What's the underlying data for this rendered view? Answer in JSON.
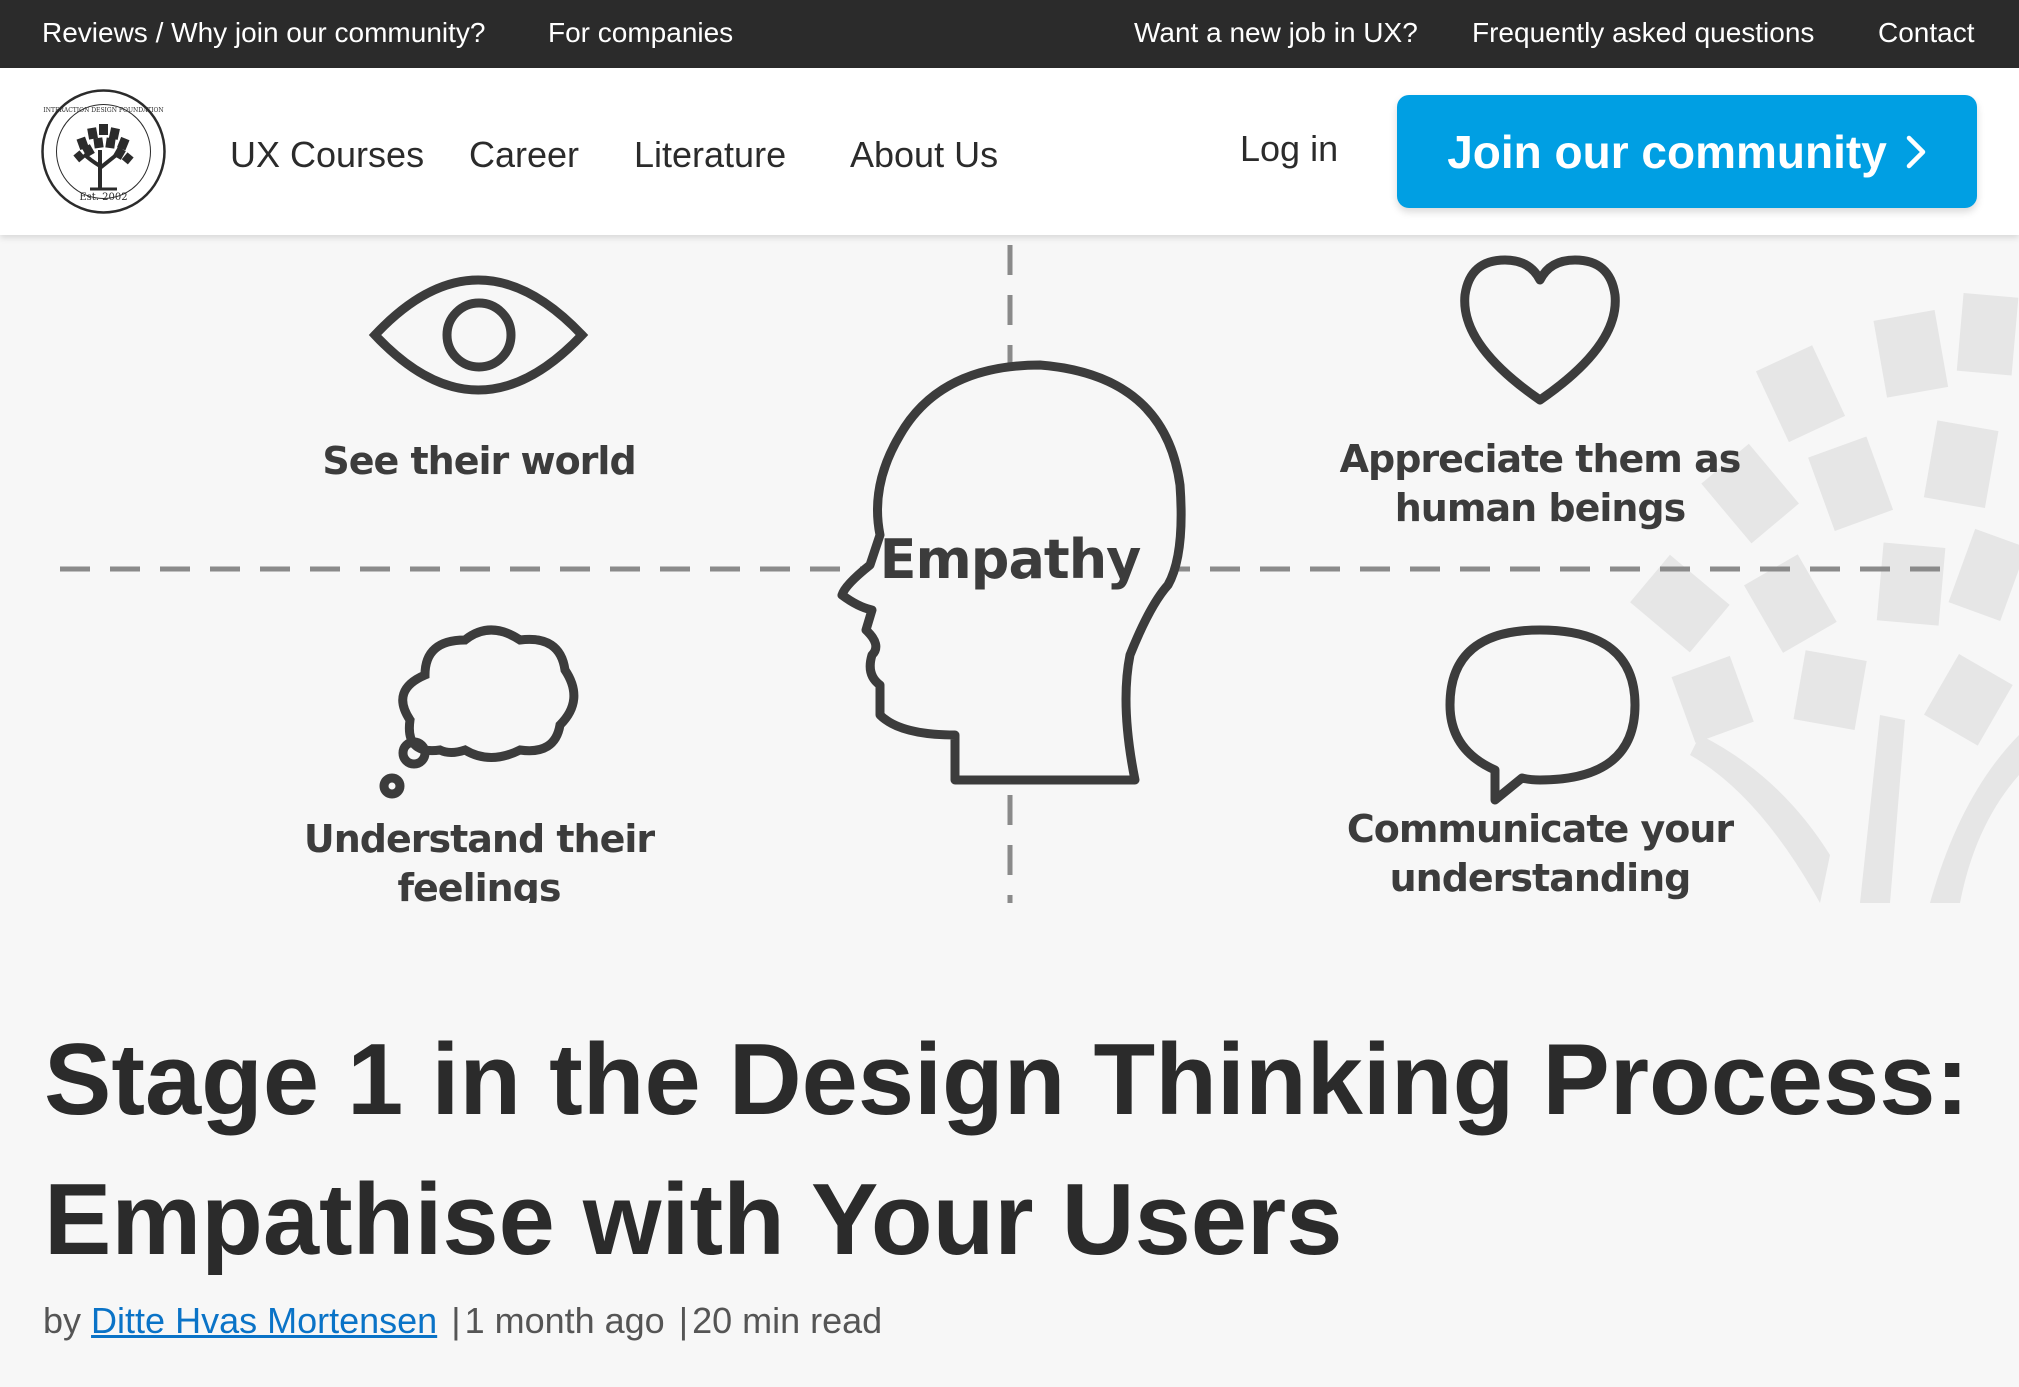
{
  "topbar": {
    "links": [
      "Reviews / Why join our community?",
      "For companies",
      "Want a new job in UX?",
      "Frequently asked questions",
      "Contact"
    ]
  },
  "nav": {
    "logo": {
      "text_top": "INTERACTION DESIGN FOUNDATION",
      "text_bottom": "Est. 2002"
    },
    "links": [
      "UX Courses",
      "Career",
      "Literature",
      "About Us"
    ],
    "login": "Log in",
    "join_button": "Join our community"
  },
  "hero": {
    "center": "Empathy",
    "labels": {
      "top_left": "See their world",
      "top_right_line1": "Appreciate them as",
      "top_right_line2": "human beings",
      "bottom_left_line1": "Understand their",
      "bottom_left_line2": "feelings",
      "bottom_right_line1": "Communicate your",
      "bottom_right_line2": "understanding"
    }
  },
  "article": {
    "title_line1": "Stage 1 in the Design Thinking Process:",
    "title_line2": "Empathise with Your Users",
    "by": "by",
    "author": "Ditte Hvas Mortensen",
    "time": "1 month ago",
    "read_time": "20 min read"
  },
  "colors": {
    "accent": "#009fe3",
    "topbar": "#2b2b2b",
    "link": "#0a73c7"
  }
}
